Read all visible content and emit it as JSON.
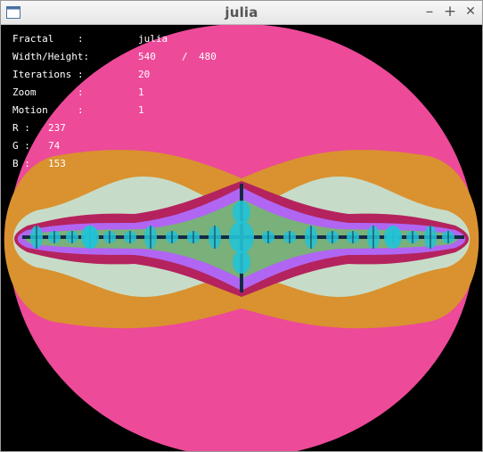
{
  "window": {
    "title": "julia",
    "minimize_glyph": "–",
    "maximize_glyph": "+",
    "close_glyph": "✕",
    "icon": "window-icon"
  },
  "info": {
    "fractal_label": "Fractal",
    "fractal_sep": ":",
    "fractal_value": "julia",
    "size_label": "Width/Height:",
    "size_width": "540",
    "size_slash": "/",
    "size_height": "480",
    "iter_label": "Iterations",
    "iter_sep": ":",
    "iter_value": "20",
    "zoom_label": "Zoom",
    "zoom_sep": ":",
    "zoom_value": "1",
    "motion_label": "Motion",
    "motion_sep": ":",
    "motion_value": "1",
    "r_label": "R :",
    "r_value": "237",
    "g_label": "G :",
    "g_value": "74",
    "b_label": "B :",
    "b_value": "153"
  },
  "colors": {
    "outer": "#ed4a99",
    "band2": "#d9922f",
    "band3": "#c7dcc8",
    "band4": "#b4235e",
    "band5": "#b066f2",
    "band6": "#7ab07a",
    "core": "#22c3d6",
    "spine": "#142a44"
  }
}
